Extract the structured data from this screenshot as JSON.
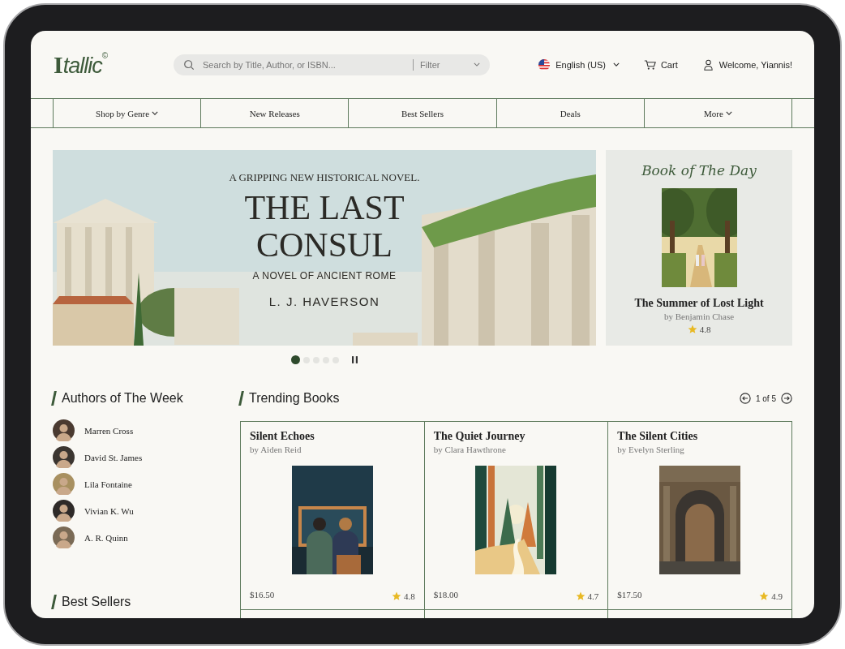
{
  "header": {
    "logo": {
      "initial": "I",
      "rest": "tallic",
      "mark": "©"
    },
    "search": {
      "placeholder": "Search by Title, Author, or ISBN...",
      "filter": "Filter"
    },
    "language": "English (US)",
    "cart": "Cart",
    "welcome": "Welcome, Yiannis!"
  },
  "nav": [
    {
      "label": "Shop by Genre",
      "has_menu": true
    },
    {
      "label": "New Releases",
      "has_menu": false
    },
    {
      "label": "Best Sellers",
      "has_menu": false
    },
    {
      "label": "Deals",
      "has_menu": false
    },
    {
      "label": "More",
      "has_menu": true
    }
  ],
  "hero": {
    "eyebrow": "A GRIPPING NEW HISTORICAL NOVEL.",
    "title": "THE LAST CONSUL",
    "subtitle": "A NOVEL OF ANCIENT ROME",
    "author": "L. J. HAVERSON",
    "slides": [
      {
        "selected": true
      },
      {
        "selected": false
      },
      {
        "selected": false
      },
      {
        "selected": false
      },
      {
        "selected": false
      }
    ]
  },
  "book_of_the_day": {
    "heading": "Book of The Day",
    "title": "The Summer of Lost Light",
    "author": "by Benjamin Chase",
    "rating": "4.8"
  },
  "authors": {
    "heading": "Authors of The Week",
    "items": [
      "Marren Cross",
      "David St. James",
      "Lila Fontaine",
      "Vivian K. Wu",
      "A. R. Quinn"
    ]
  },
  "best_sellers": {
    "heading": "Best Sellers"
  },
  "trending": {
    "heading": "Trending Books",
    "pager": "1 of 5",
    "books": [
      {
        "title": "Silent Echoes",
        "author": "by Aiden Reid",
        "price": "$16.50",
        "rating": "4.8"
      },
      {
        "title": "The Quiet Journey",
        "author": "by Clara Hawthrone",
        "price": "$18.00",
        "rating": "4.7"
      },
      {
        "title": "The Silent Cities",
        "author": "by Evelyn Sterling",
        "price": "$17.50",
        "rating": "4.9"
      }
    ]
  }
}
